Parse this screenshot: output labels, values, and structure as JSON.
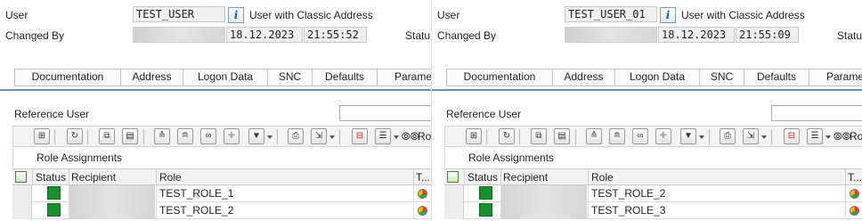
{
  "panes": [
    {
      "user_label": "User",
      "user_value": "TEST_USER",
      "user_type": "User with Classic Address",
      "changed_by_label": "Changed By",
      "date": "18.12.2023",
      "time": "21:55:52",
      "status_cut": "Statu",
      "tabs": [
        "Documentation",
        "Address",
        "Logon Data",
        "SNC",
        "Defaults",
        "Parame"
      ],
      "ref_user_label": "Reference User",
      "toolbar_text": "Rol",
      "grid_title": "Role Assignments",
      "columns": [
        "Status",
        "Recipient",
        "Role",
        "T..."
      ],
      "rows": [
        {
          "role": "TEST_ROLE_1"
        },
        {
          "role": "TEST_ROLE_2"
        }
      ]
    },
    {
      "user_label": "User",
      "user_value": "TEST_USER_01",
      "user_type": "User with Classic Address",
      "changed_by_label": "Changed By",
      "date": "18.12.2023",
      "time": "21:55:09",
      "status_cut": "Statu",
      "tabs": [
        "Documentation",
        "Address",
        "Logon Data",
        "SNC",
        "Defaults",
        "Parame"
      ],
      "ref_user_label": "Reference User",
      "toolbar_text": "Rol",
      "grid_title": "Role Assignments",
      "columns": [
        "Status",
        "Recipient",
        "Role",
        "T..."
      ],
      "rows": [
        {
          "role": "TEST_ROLE_2"
        },
        {
          "role": "TEST_ROLE_3"
        }
      ]
    }
  ],
  "icons": {
    "info": "i",
    "find": "⊞",
    "refresh": "↻",
    "copy": "⧉",
    "paste": "▤",
    "sort_asc": "≙",
    "sort_desc": "≘",
    "binoculars": "∞",
    "binoculars_next": "✚",
    "filter": "▼",
    "print": "⎙",
    "export": "⇲",
    "delete": "⊟",
    "select_layout": "☰",
    "glasses": "⦾⦾"
  },
  "colors": {
    "status_green": "#1a8f2d",
    "separator_blue": "#6f8db0"
  }
}
